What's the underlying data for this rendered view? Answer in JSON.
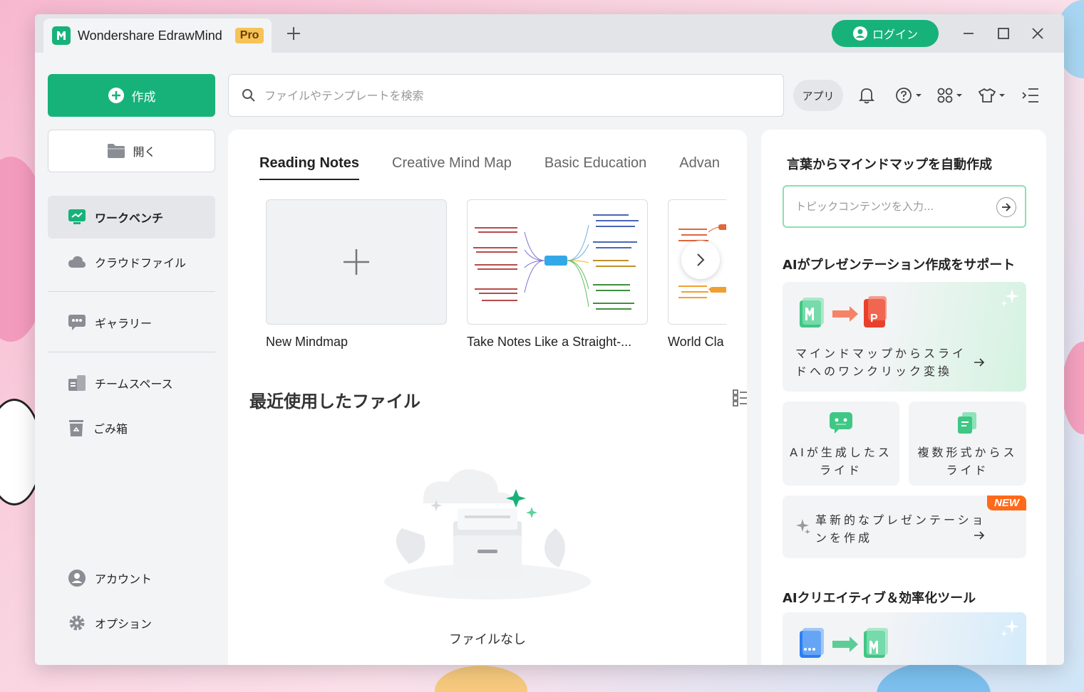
{
  "window": {
    "app_title": "Wondershare EdrawMind",
    "pro_badge": "Pro",
    "login_label": "ログイン"
  },
  "sidebar": {
    "create_label": "作成",
    "open_label": "開く",
    "items": [
      {
        "label": "ワークベンチ",
        "icon": "workbench-icon",
        "active": true
      },
      {
        "label": "クラウドファイル",
        "icon": "cloud-icon"
      },
      {
        "label": "ギャラリー",
        "icon": "gallery-icon"
      },
      {
        "label": "チームスペース",
        "icon": "team-space-icon"
      },
      {
        "label": "ごみ箱",
        "icon": "trash-icon"
      }
    ],
    "bottom": [
      {
        "label": "アカウント",
        "icon": "account-icon"
      },
      {
        "label": "オプション",
        "icon": "gear-icon"
      }
    ]
  },
  "toolbar": {
    "search_placeholder": "ファイルやテンプレートを検索",
    "apps_label": "アプリ"
  },
  "templates": {
    "tabs": [
      "Reading Notes",
      "Creative Mind Map",
      "Basic Education",
      "Advan"
    ],
    "cards": [
      {
        "title": "New Mindmap"
      },
      {
        "title": "Take Notes Like a Straight-..."
      },
      {
        "title": "World Cla"
      }
    ]
  },
  "recent": {
    "title": "最近使用したファイル",
    "empty_label": "ファイルなし"
  },
  "ai_panel": {
    "text_to_map_heading": "言葉からマインドマップを自動作成",
    "topic_placeholder": "トピックコンテンツを入力...",
    "presentation_heading": "AIがプレゼンテーション作成をサポート",
    "mindmap_to_slide": "マインドマップからスライドへのワンクリック変換",
    "ai_generated_slide": "AIが生成したスライド",
    "multi_format_slide": "複数形式からスライド",
    "innovative_presentation": "革新的なプレゼンテーションを作成",
    "new_badge": "NEW",
    "creative_tools_heading": "AIクリエイティブ＆効率化ツール"
  },
  "colors": {
    "accent": "#17b27a",
    "new_badge": "#ff6a1a",
    "pro_badge": "#f6c356"
  }
}
